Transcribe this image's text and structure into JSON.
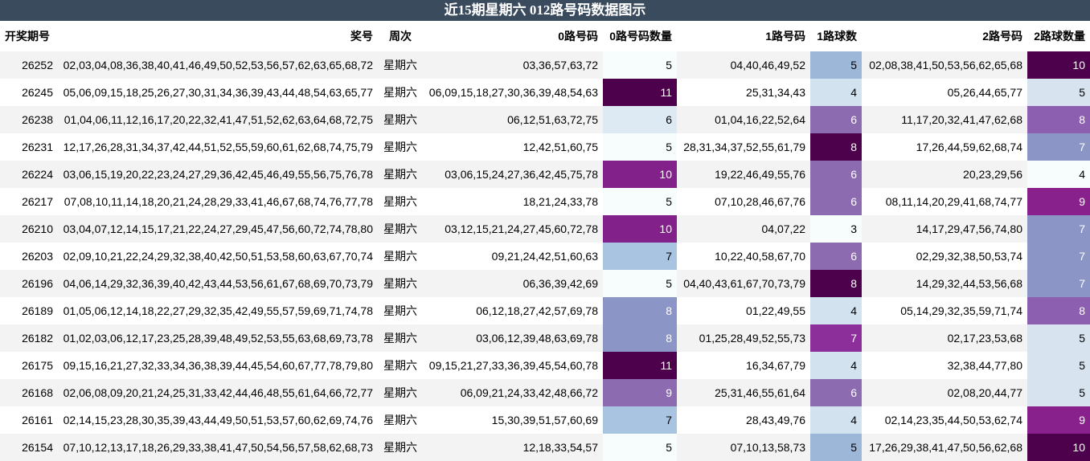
{
  "title": "近15期星期六 012路号码数据图示",
  "headers": [
    "开奖期号",
    "奖号",
    "周次",
    "0路号码",
    "0路号码数量",
    "1路号码",
    "1路球数",
    "2路号码",
    "2路球数量"
  ],
  "rows": [
    [
      "26252",
      "02,03,04,08,36,38,40,41,46,49,50,52,53,56,57,62,63,65,68,72",
      "星期六",
      "03,36,57,63,72",
      "5",
      "04,40,46,49,52",
      "5",
      "02,08,38,41,50,53,56,62,65,68",
      "10"
    ],
    [
      "26245",
      "05,06,09,15,18,25,26,27,30,31,34,36,39,43,44,48,54,63,65,77",
      "星期六",
      "06,09,15,18,27,30,36,39,48,54,63",
      "11",
      "25,31,34,43",
      "4",
      "05,26,44,65,77",
      "5"
    ],
    [
      "26238",
      "01,04,06,11,12,16,17,20,22,32,41,47,51,52,62,63,64,68,72,75",
      "星期六",
      "06,12,51,63,72,75",
      "6",
      "01,04,16,22,52,64",
      "6",
      "11,17,20,32,41,47,62,68",
      "8"
    ],
    [
      "26231",
      "12,17,26,28,31,34,37,42,44,51,52,55,59,60,61,62,68,74,75,79",
      "星期六",
      "12,42,51,60,75",
      "5",
      "28,31,34,37,52,55,61,79",
      "8",
      "17,26,44,59,62,68,74",
      "7"
    ],
    [
      "26224",
      "03,06,15,19,20,22,23,24,27,29,36,42,45,46,49,55,56,75,76,78",
      "星期六",
      "03,06,15,24,27,36,42,45,75,78",
      "10",
      "19,22,46,49,55,76",
      "6",
      "20,23,29,56",
      "4"
    ],
    [
      "26217",
      "07,08,10,11,14,18,20,21,24,28,29,33,41,46,67,68,74,76,77,78",
      "星期六",
      "18,21,24,33,78",
      "5",
      "07,10,28,46,67,76",
      "6",
      "08,11,14,20,29,41,68,74,77",
      "9"
    ],
    [
      "26210",
      "03,04,07,12,14,15,17,21,22,24,27,29,45,47,56,60,72,74,78,80",
      "星期六",
      "03,12,15,21,24,27,45,60,72,78",
      "10",
      "04,07,22",
      "3",
      "14,17,29,47,56,74,80",
      "7"
    ],
    [
      "26203",
      "02,09,10,21,22,24,29,32,38,40,42,50,51,53,58,60,63,67,70,74",
      "星期六",
      "09,21,24,42,51,60,63",
      "7",
      "10,22,40,58,67,70",
      "6",
      "02,29,32,38,50,53,74",
      "7"
    ],
    [
      "26196",
      "04,06,14,29,32,36,39,40,42,43,44,53,56,61,67,68,69,70,73,79",
      "星期六",
      "06,36,39,42,69",
      "5",
      "04,40,43,61,67,70,73,79",
      "8",
      "14,29,32,44,53,56,68",
      "7"
    ],
    [
      "26189",
      "01,05,06,12,14,18,22,27,29,32,35,42,49,55,57,59,69,71,74,78",
      "星期六",
      "06,12,18,27,42,57,69,78",
      "8",
      "01,22,49,55",
      "4",
      "05,14,29,32,35,59,71,74",
      "8"
    ],
    [
      "26182",
      "01,02,03,06,12,17,23,25,28,39,48,49,52,53,55,63,68,69,73,78",
      "星期六",
      "03,06,12,39,48,63,69,78",
      "8",
      "01,25,28,49,52,55,73",
      "7",
      "02,17,23,53,68",
      "5"
    ],
    [
      "26175",
      "09,15,16,21,27,32,33,34,36,38,39,44,45,54,60,67,77,78,79,80",
      "星期六",
      "09,15,21,27,33,36,39,45,54,60,78",
      "11",
      "16,34,67,79",
      "4",
      "32,38,44,77,80",
      "5"
    ],
    [
      "26168",
      "02,06,08,09,20,21,24,25,31,33,42,44,46,48,55,61,64,66,72,77",
      "星期六",
      "06,09,21,24,33,42,48,66,72",
      "9",
      "25,31,46,55,61,64",
      "6",
      "02,08,20,44,77",
      "5"
    ],
    [
      "26161",
      "02,14,15,23,28,30,35,39,43,44,49,50,51,53,57,60,62,69,74,76",
      "星期六",
      "15,30,39,51,57,60,69",
      "7",
      "28,43,49,76",
      "4",
      "02,14,23,35,44,50,53,62,74",
      "9"
    ],
    [
      "26154",
      "07,10,12,13,17,18,26,29,33,38,41,47,50,54,56,57,58,62,68,73",
      "星期六",
      "12,18,33,54,57",
      "5",
      "07,10,13,58,73",
      "5",
      "17,26,29,38,41,47,50,56,62,68",
      "10"
    ]
  ],
  "heat_colors": {
    "3": "#f7fcfd",
    "4": "#e0ecf4",
    "5": "#bfd3e6",
    "6": "#9ebcda",
    "7": "#8c96c6",
    "8": "#8c6bb1",
    "9": "#88419d",
    "10": "#810f7c",
    "11": "#4d004b"
  },
  "heat_colors_0": {
    "5": "#f7fcfd",
    "6": "#dde9f3",
    "7": "#a9c4e0",
    "8": "#8c96c6",
    "9": "#8c6bb1",
    "10": "#82218a",
    "11": "#4d004b"
  },
  "heat_colors_1": {
    "3": "#f7fcfd",
    "4": "#d2e2ef",
    "5": "#9db7d9",
    "6": "#8c6bb1",
    "7": "#8c2f9b",
    "8": "#4d004b"
  },
  "heat_colors_2": {
    "4": "#f7fcfd",
    "5": "#d7e4f0",
    "7": "#8c96c6",
    "8": "#8c5fb0",
    "9": "#88218c",
    "10": "#4d004b"
  }
}
